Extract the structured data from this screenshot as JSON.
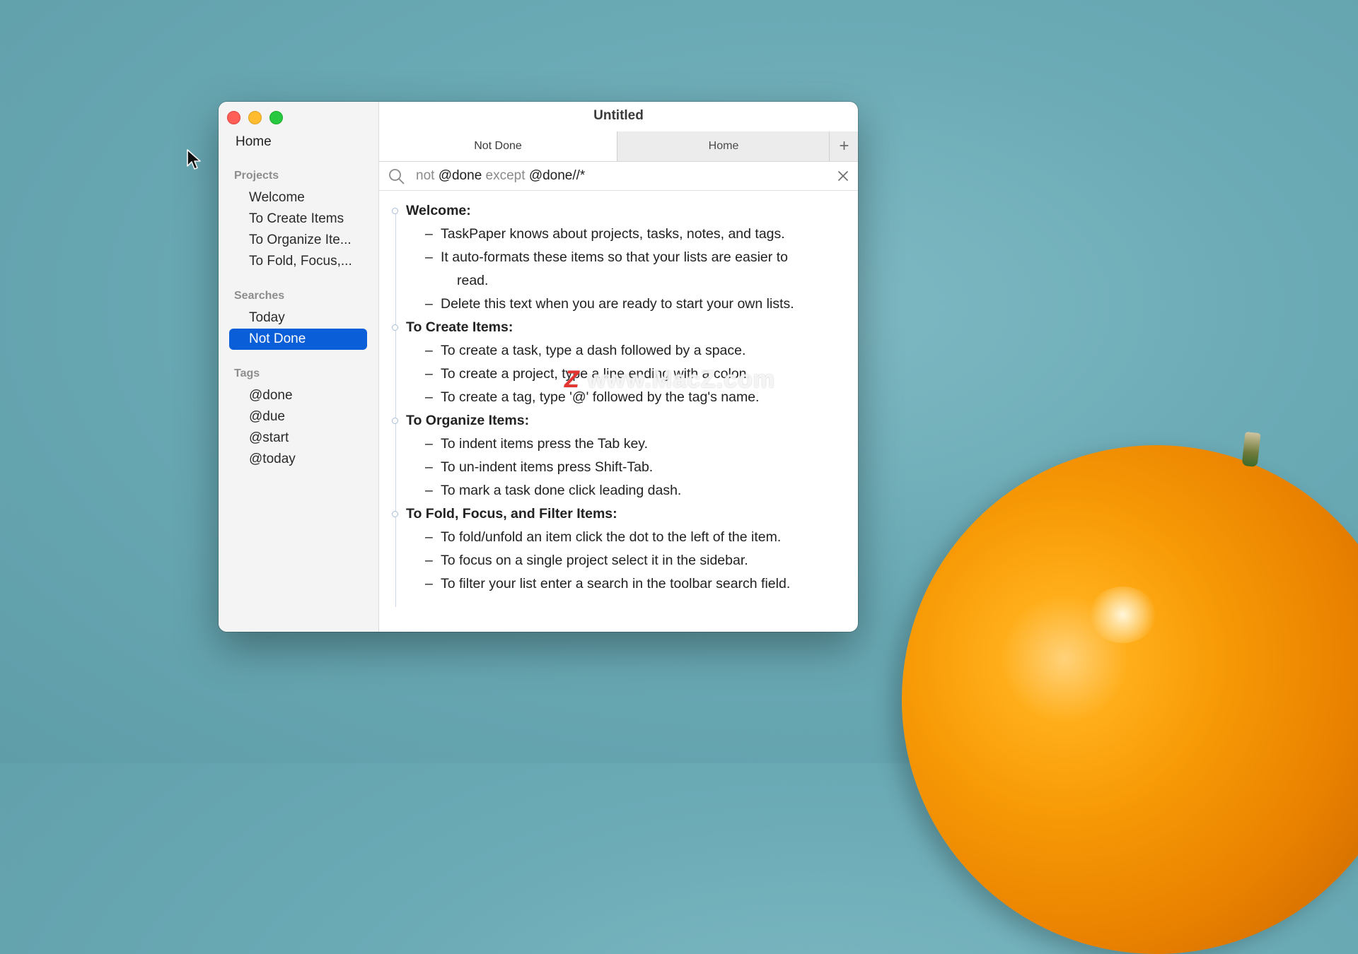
{
  "window": {
    "title": "Untitled"
  },
  "sidebar": {
    "home": "Home",
    "projects_title": "Projects",
    "projects": [
      "Welcome",
      "To Create Items",
      "To Organize Ite...",
      "To Fold, Focus,..."
    ],
    "searches_title": "Searches",
    "searches": [
      "Today",
      "Not Done"
    ],
    "selected_search": "Not Done",
    "tags_title": "Tags",
    "tags": [
      "@done",
      "@due",
      "@start",
      "@today"
    ]
  },
  "tabs": {
    "active": "Not Done",
    "inactive": "Home",
    "add": "+"
  },
  "search": {
    "q_not": "not",
    "q_done": "@done",
    "q_except": "except",
    "q_pattern": "@done//*"
  },
  "outline": [
    {
      "type": "project",
      "text": "Welcome:"
    },
    {
      "type": "task",
      "text": "TaskPaper knows about projects, tasks, notes, and tags."
    },
    {
      "type": "task",
      "text": "It auto-formats these items so that your lists are easier to"
    },
    {
      "type": "cont",
      "text": "read."
    },
    {
      "type": "task",
      "text": "Delete this text when you are ready to start your own lists."
    },
    {
      "type": "project",
      "text": "To Create Items:"
    },
    {
      "type": "task",
      "text": "To create a task, type a dash followed by a space."
    },
    {
      "type": "task",
      "text": "To create a project, type a line ending with a colon."
    },
    {
      "type": "task",
      "text": "To create a tag, type '@' followed by the tag's name."
    },
    {
      "type": "project",
      "text": "To Organize Items:"
    },
    {
      "type": "task",
      "text": "To indent items press the Tab key."
    },
    {
      "type": "task",
      "text": "To un-indent items press Shift-Tab."
    },
    {
      "type": "task",
      "text": "To mark a task done click leading dash."
    },
    {
      "type": "project",
      "text": "To Fold, Focus, and Filter Items:"
    },
    {
      "type": "task",
      "text": "To fold/unfold an item click the dot to the left of the item."
    },
    {
      "type": "task",
      "text": "To focus on a single project select it in the sidebar."
    },
    {
      "type": "task",
      "text": "To filter your list enter a search in the toolbar search field."
    }
  ],
  "dash_glyph": "–",
  "watermark": {
    "z": "Z",
    "text": " www.MacZ.com"
  },
  "icons": [
    "search-icon",
    "clear-search-icon",
    "pointer-cursor-icon"
  ],
  "colors": {
    "selection": "#0a5fd8",
    "close": "#ff5f57",
    "minimize": "#febc2e",
    "zoom": "#28c840"
  }
}
